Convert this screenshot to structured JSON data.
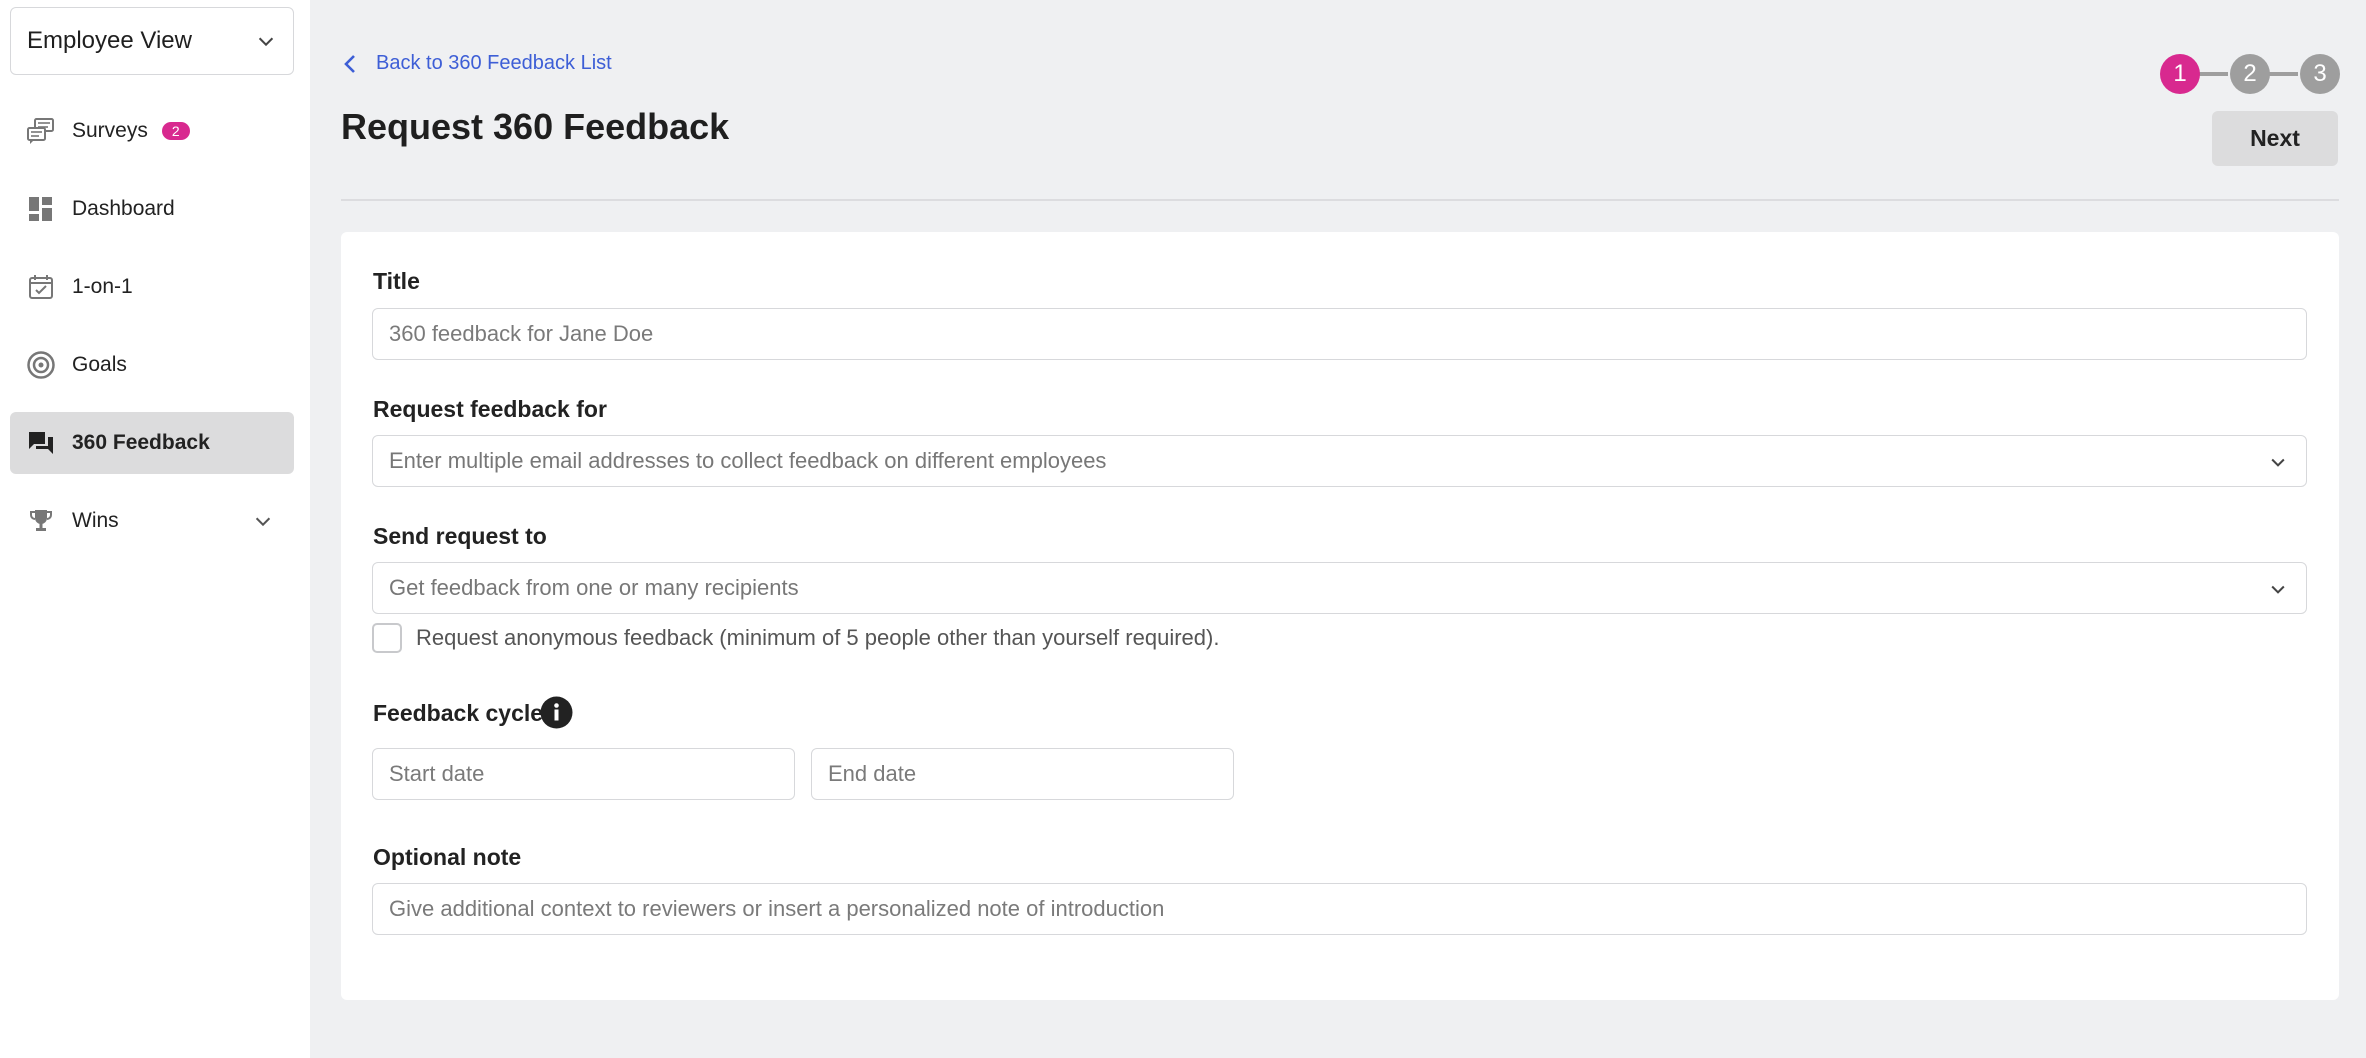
{
  "sidebar": {
    "view_selector": "Employee View",
    "items": [
      {
        "label": "Surveys",
        "badge": "2",
        "icon": "survey-icon"
      },
      {
        "label": "Dashboard",
        "icon": "dashboard-icon"
      },
      {
        "label": "1-on-1",
        "icon": "calendar-check-icon"
      },
      {
        "label": "Goals",
        "icon": "target-icon"
      },
      {
        "label": "360 Feedback",
        "icon": "chat-icon",
        "active": true
      },
      {
        "label": "Wins",
        "icon": "trophy-icon"
      }
    ]
  },
  "header": {
    "back_link": "Back to 360 Feedback List",
    "title": "Request 360 Feedback",
    "steps": [
      "1",
      "2",
      "3"
    ],
    "active_step": "1",
    "next_label": "Next"
  },
  "form": {
    "title_label": "Title",
    "title_placeholder": "360 feedback for Jane Doe",
    "request_for_label": "Request feedback for",
    "request_for_placeholder": "Enter multiple email addresses to collect feedback on different employees",
    "send_to_label": "Send request to",
    "send_to_placeholder": "Get feedback from one or many recipients",
    "anonymous_label": "Request anonymous feedback (minimum of 5 people other than yourself required).",
    "cycle_label": "Feedback cycle",
    "start_placeholder": "Start date",
    "end_placeholder": "End date",
    "note_label": "Optional note",
    "note_placeholder": "Give additional context to reviewers or insert a personalized note of introduction"
  },
  "colors": {
    "accent": "#d8298f",
    "link": "#3d5ed6",
    "background": "#eff0f2"
  }
}
